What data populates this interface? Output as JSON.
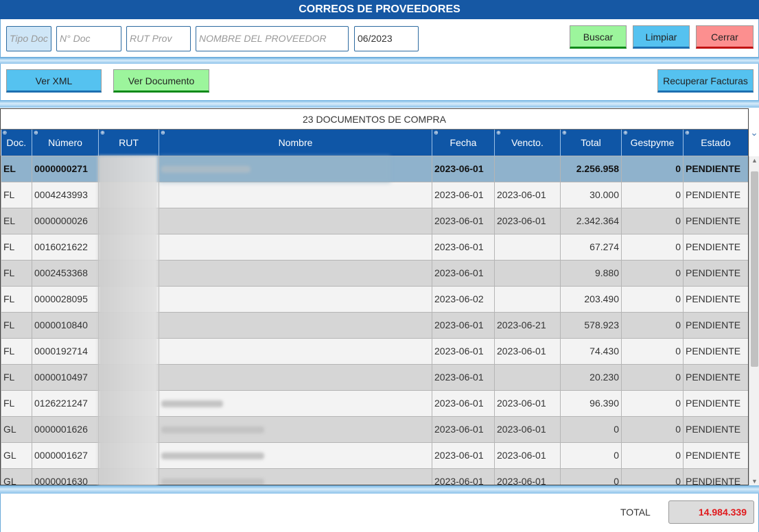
{
  "window": {
    "title": "CORREOS DE PROVEEDORES"
  },
  "filters": {
    "tipo_doc_placeholder": "Tipo Doc",
    "num_doc_placeholder": "N° Doc",
    "rut_prov_placeholder": "RUT Prov",
    "nombre_placeholder": "NOMBRE DEL PROVEEDOR",
    "periodo_value": "06/2023"
  },
  "buttons": {
    "buscar": "Buscar",
    "limpiar": "Limpiar",
    "cerrar": "Cerrar",
    "ver_xml": "Ver XML",
    "ver_documento": "Ver Documento",
    "recuperar_facturas": "Recuperar Facturas"
  },
  "grid": {
    "caption": "23 DOCUMENTOS DE COMPRA",
    "columns": [
      "Doc.",
      "Número",
      "RUT",
      "Nombre",
      "Fecha",
      "Vencto.",
      "Total",
      "Gestpyme",
      "Estado"
    ],
    "rows": [
      {
        "doc": "EL",
        "numero": "0000000271",
        "fecha": "2023-06-01",
        "vencto": "",
        "total": "2.256.958",
        "gestpyme": "0",
        "estado": "PENDIENTE"
      },
      {
        "doc": "FL",
        "numero": "0004243993",
        "fecha": "2023-06-01",
        "vencto": "2023-06-01",
        "total": "30.000",
        "gestpyme": "0",
        "estado": "PENDIENTE"
      },
      {
        "doc": "EL",
        "numero": "0000000026",
        "fecha": "2023-06-01",
        "vencto": "2023-06-01",
        "total": "2.342.364",
        "gestpyme": "0",
        "estado": "PENDIENTE"
      },
      {
        "doc": "FL",
        "numero": "0016021622",
        "fecha": "2023-06-01",
        "vencto": "",
        "total": "67.274",
        "gestpyme": "0",
        "estado": "PENDIENTE"
      },
      {
        "doc": "FL",
        "numero": "0002453368",
        "fecha": "2023-06-01",
        "vencto": "",
        "total": "9.880",
        "gestpyme": "0",
        "estado": "PENDIENTE"
      },
      {
        "doc": "FL",
        "numero": "0000028095",
        "fecha": "2023-06-02",
        "vencto": "",
        "total": "203.490",
        "gestpyme": "0",
        "estado": "PENDIENTE"
      },
      {
        "doc": "FL",
        "numero": "0000010840",
        "fecha": "2023-06-01",
        "vencto": "2023-06-21",
        "total": "578.923",
        "gestpyme": "0",
        "estado": "PENDIENTE"
      },
      {
        "doc": "FL",
        "numero": "0000192714",
        "fecha": "2023-06-01",
        "vencto": "2023-06-01",
        "total": "74.430",
        "gestpyme": "0",
        "estado": "PENDIENTE"
      },
      {
        "doc": "FL",
        "numero": "0000010497",
        "fecha": "2023-06-01",
        "vencto": "",
        "total": "20.230",
        "gestpyme": "0",
        "estado": "PENDIENTE"
      },
      {
        "doc": "FL",
        "numero": "0126221247",
        "fecha": "2023-06-01",
        "vencto": "2023-06-01",
        "total": "96.390",
        "gestpyme": "0",
        "estado": "PENDIENTE"
      },
      {
        "doc": "GL",
        "numero": "0000001626",
        "fecha": "2023-06-01",
        "vencto": "2023-06-01",
        "total": "0",
        "gestpyme": "0",
        "estado": "PENDIENTE"
      },
      {
        "doc": "GL",
        "numero": "0000001627",
        "fecha": "2023-06-01",
        "vencto": "2023-06-01",
        "total": "0",
        "gestpyme": "0",
        "estado": "PENDIENTE"
      },
      {
        "doc": "GL",
        "numero": "0000001630",
        "fecha": "2023-06-01",
        "vencto": "2023-06-01",
        "total": "0",
        "gestpyme": "0",
        "estado": "PENDIENTE"
      }
    ]
  },
  "footer": {
    "total_label": "TOTAL",
    "total_value": "14.984.339"
  },
  "colors": {
    "header_blue": "#1658a4",
    "selected_row": "#8fb2cc",
    "total_red": "#e0181b"
  },
  "icons": [
    "chevron-down-icon",
    "scroll-up-arrow-icon",
    "scroll-down-arrow-icon"
  ]
}
